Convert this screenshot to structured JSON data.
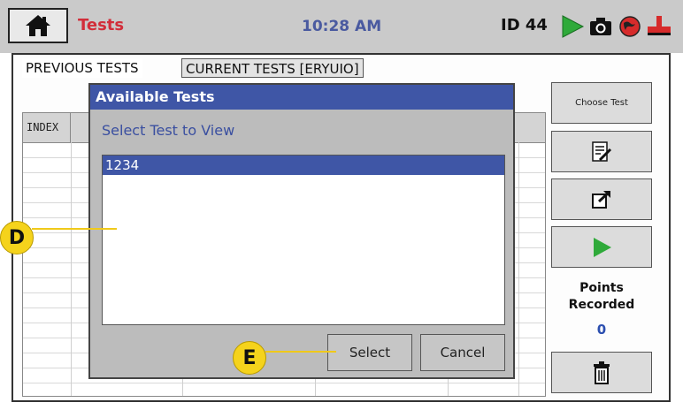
{
  "header": {
    "title": "Tests",
    "time": "10:28 AM",
    "device_id": "ID 44",
    "icons": [
      "home-icon",
      "play-icon",
      "camera-icon",
      "globe-icon",
      "valve-icon"
    ]
  },
  "tabs": [
    {
      "label": "PREVIOUS TESTS"
    },
    {
      "label": "CURRENT TESTS [ERYUIO]"
    }
  ],
  "table": {
    "columns": [
      "INDEX"
    ]
  },
  "sidebar": {
    "choose_test": "Choose Test",
    "points_label": "Points Recorded",
    "points_value": "0"
  },
  "dialog": {
    "title": "Available Tests",
    "prompt": "Select Test to View",
    "items": [
      "1234"
    ],
    "select_label": "Select",
    "cancel_label": "Cancel"
  },
  "callouts": [
    "D",
    "E"
  ],
  "colors": {
    "title_red": "#d22e3a",
    "accent_blue": "#3f56a6",
    "play_green": "#2faa3a",
    "callout_yellow": "#f5d31c"
  }
}
